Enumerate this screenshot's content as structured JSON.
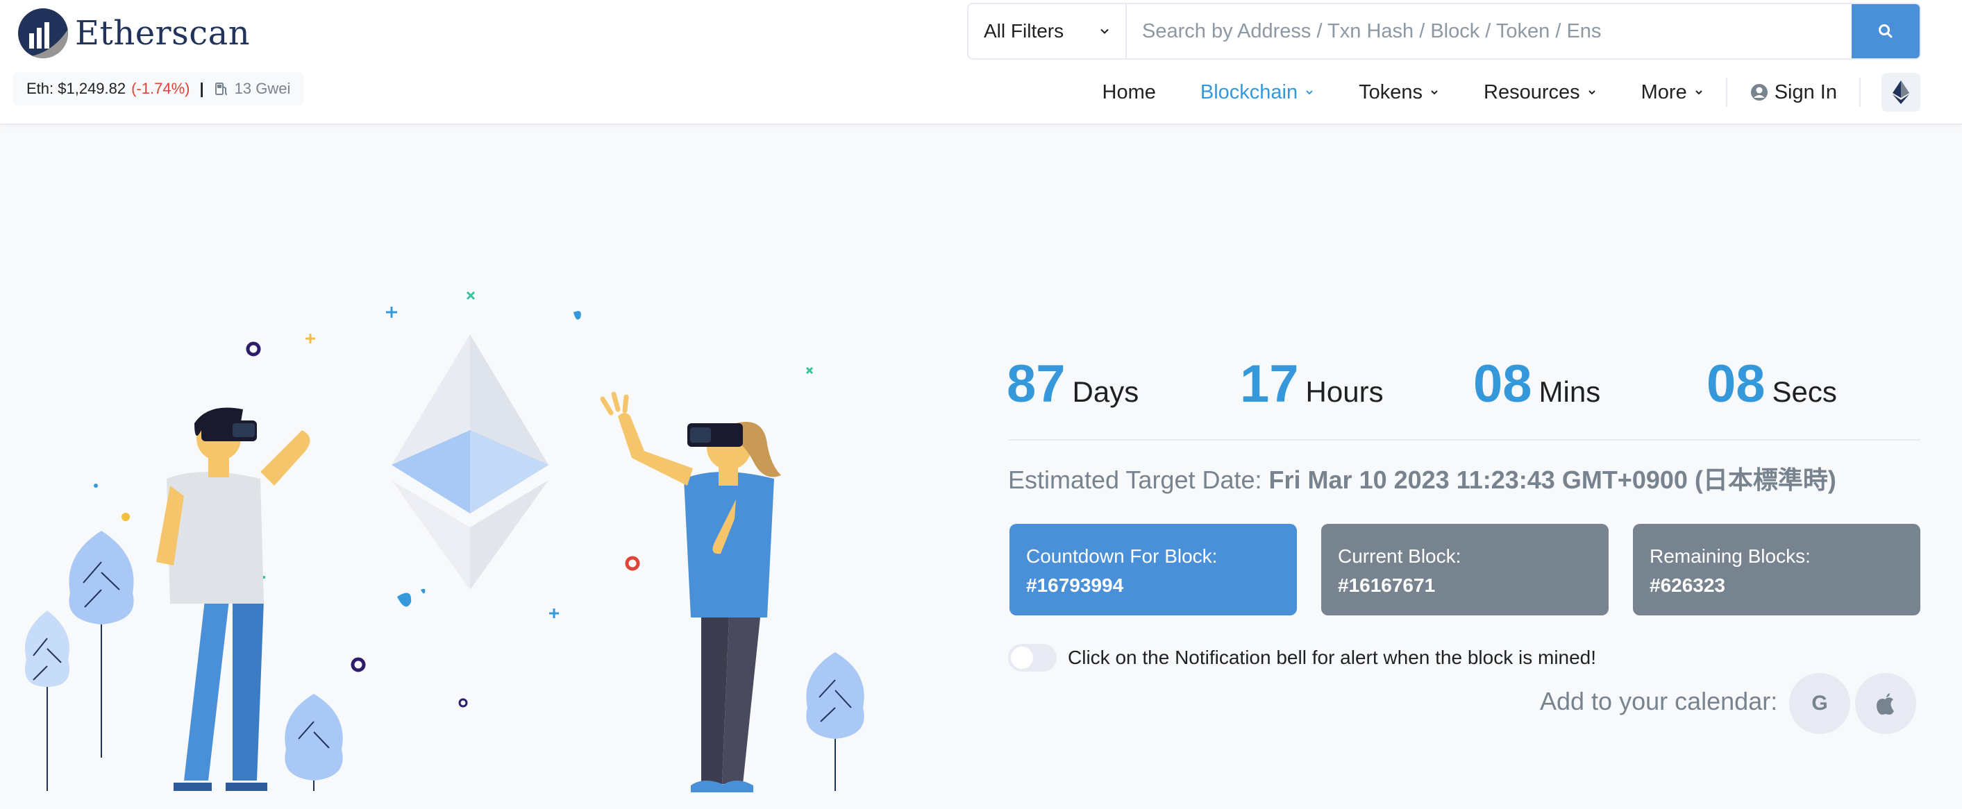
{
  "brand": {
    "name": "Etherscan"
  },
  "price_bar": {
    "price": "Eth: $1,249.82",
    "change": "(-1.74%)",
    "separator": "|",
    "gas": "13 Gwei"
  },
  "search": {
    "filter_label": "All Filters",
    "placeholder": "Search by Address / Txn Hash / Block / Token / Ens"
  },
  "nav": {
    "items": [
      {
        "label": "Home"
      },
      {
        "label": "Blockchain",
        "active": true
      },
      {
        "label": "Tokens"
      },
      {
        "label": "Resources"
      },
      {
        "label": "More"
      }
    ],
    "signin": "Sign In"
  },
  "countdown": {
    "days": "87",
    "days_label": "Days",
    "hours": "17",
    "hours_label": "Hours",
    "mins": "08",
    "mins_label": "Mins",
    "secs": "08",
    "secs_label": "Secs"
  },
  "target": {
    "label": "Estimated Target Date:",
    "value": "Fri Mar 10 2023 11:23:43 GMT+0900 (日本標準時)"
  },
  "cards": [
    {
      "label": "Countdown For Block:",
      "value": "#16793994"
    },
    {
      "label": "Current Block:",
      "value": "#16167671"
    },
    {
      "label": "Remaining Blocks:",
      "value": "#626323"
    }
  ],
  "notification": {
    "text": "Click on the Notification bell for alert when the block is mined!"
  },
  "calendar": {
    "label": "Add to your calendar:",
    "google": "G"
  },
  "colors": {
    "primary": "#3498db",
    "button": "#4a90d8",
    "muted": "#77838f",
    "negative": "#de4437",
    "brand": "#21325b"
  },
  "icons": [
    "etherscan-logo",
    "gas-pump-icon",
    "chevron-down-icon",
    "search-icon",
    "user-circle-icon",
    "ethereum-icon",
    "apple-icon",
    "google-icon"
  ]
}
